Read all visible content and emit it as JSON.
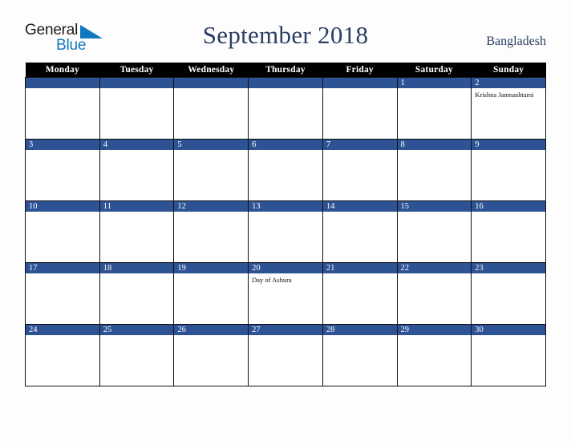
{
  "brand": {
    "word_one": "General",
    "word_two": "Blue",
    "triangle_icon": "triangle-icon",
    "accent_color": "#1278be"
  },
  "header": {
    "title": "September 2018",
    "region": "Bangladesh",
    "title_color": "#2b3e63"
  },
  "calendar": {
    "weekday_headers": [
      "Monday",
      "Tuesday",
      "Wednesday",
      "Thursday",
      "Friday",
      "Saturday",
      "Sunday"
    ],
    "header_bg": "#000000",
    "daybar_bg": "#2e5395",
    "weeks": [
      [
        {
          "date": ""
        },
        {
          "date": ""
        },
        {
          "date": ""
        },
        {
          "date": ""
        },
        {
          "date": ""
        },
        {
          "date": "1"
        },
        {
          "date": "2",
          "events": [
            "Krishna Janmashtami"
          ]
        }
      ],
      [
        {
          "date": "3"
        },
        {
          "date": "4"
        },
        {
          "date": "5"
        },
        {
          "date": "6"
        },
        {
          "date": "7"
        },
        {
          "date": "8"
        },
        {
          "date": "9"
        }
      ],
      [
        {
          "date": "10"
        },
        {
          "date": "11"
        },
        {
          "date": "12"
        },
        {
          "date": "13"
        },
        {
          "date": "14"
        },
        {
          "date": "15"
        },
        {
          "date": "16"
        }
      ],
      [
        {
          "date": "17"
        },
        {
          "date": "18"
        },
        {
          "date": "19"
        },
        {
          "date": "20",
          "events": [
            "Day of Ashura"
          ]
        },
        {
          "date": "21"
        },
        {
          "date": "22"
        },
        {
          "date": "23"
        }
      ],
      [
        {
          "date": "24"
        },
        {
          "date": "25"
        },
        {
          "date": "26"
        },
        {
          "date": "27"
        },
        {
          "date": "28"
        },
        {
          "date": "29"
        },
        {
          "date": "30"
        }
      ]
    ]
  }
}
